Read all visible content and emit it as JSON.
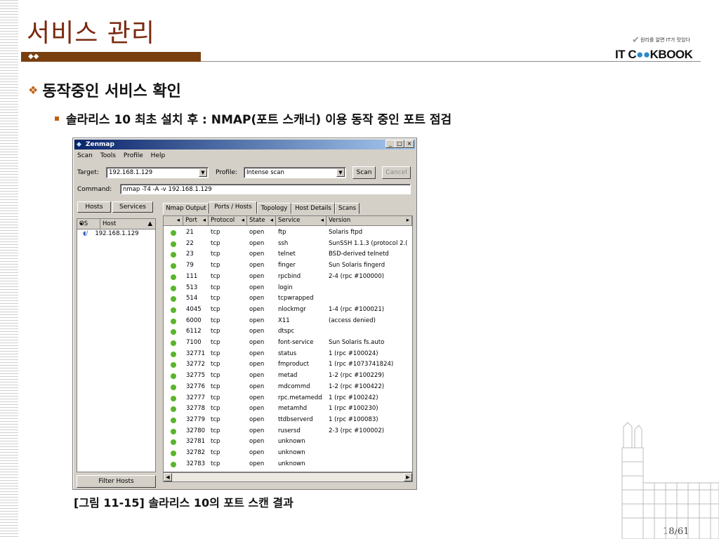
{
  "slide": {
    "title": "서비스 관리",
    "bullet1": "동작중인 서비스 확인",
    "bullet2": "솔라리스 10 최초 설치 후 : NMAP(포트 스캐너) 이용 동작 중인 포트 점검",
    "caption": "[그림 11-15] 솔라리스 10의 포트 스캔 결과",
    "page_number": "18/61",
    "logo_tagline": "원리를 알면 IT가 맛있다",
    "logo_brand_left": "IT C",
    "logo_brand_oo": "●●",
    "logo_brand_right": "KBOOK"
  },
  "window": {
    "title": "Zenmap",
    "controls": [
      "_",
      "□",
      "×"
    ],
    "menu": [
      "Scan",
      "Tools",
      "Profile",
      "Help"
    ],
    "target_label": "Target:",
    "target_value": "192.168.1.129",
    "profile_label": "Profile:",
    "profile_value": "Intense scan",
    "scan_button": "Scan",
    "cancel_button": "Cancel",
    "command_label": "Command:",
    "command_value": "nmap -T4 -A -v 192.168.1.129",
    "left_tabs": [
      "Hosts",
      "Services"
    ],
    "host_columns": [
      "OS",
      "Host"
    ],
    "hosts": [
      "192.168.1.129"
    ],
    "filter_button": "Filter Hosts",
    "tabs": [
      "Nmap Output",
      "Ports / Hosts",
      "Topology",
      "Host Details",
      "Scans"
    ],
    "active_tab": "Ports / Hosts",
    "port_columns": [
      "Port",
      "Protocol",
      "State",
      "Service",
      "Version"
    ],
    "ports": [
      {
        "port": "21",
        "protocol": "tcp",
        "state": "open",
        "service": "ftp",
        "version": "Solaris ftpd"
      },
      {
        "port": "22",
        "protocol": "tcp",
        "state": "open",
        "service": "ssh",
        "version": "SunSSH 1.1.3 (protocol 2.("
      },
      {
        "port": "23",
        "protocol": "tcp",
        "state": "open",
        "service": "telnet",
        "version": "BSD-derived telnetd"
      },
      {
        "port": "79",
        "protocol": "tcp",
        "state": "open",
        "service": "finger",
        "version": "Sun Solaris fingerd"
      },
      {
        "port": "111",
        "protocol": "tcp",
        "state": "open",
        "service": "rpcbind",
        "version": "2-4 (rpc #100000)"
      },
      {
        "port": "513",
        "protocol": "tcp",
        "state": "open",
        "service": "login",
        "version": ""
      },
      {
        "port": "514",
        "protocol": "tcp",
        "state": "open",
        "service": "tcpwrapped",
        "version": ""
      },
      {
        "port": "4045",
        "protocol": "tcp",
        "state": "open",
        "service": "nlockmgr",
        "version": "1-4 (rpc #100021)"
      },
      {
        "port": "6000",
        "protocol": "tcp",
        "state": "open",
        "service": "X11",
        "version": "(access denied)"
      },
      {
        "port": "6112",
        "protocol": "tcp",
        "state": "open",
        "service": "dtspc",
        "version": ""
      },
      {
        "port": "7100",
        "protocol": "tcp",
        "state": "open",
        "service": "font-service",
        "version": "Sun Solaris fs.auto"
      },
      {
        "port": "32771",
        "protocol": "tcp",
        "state": "open",
        "service": "status",
        "version": "1 (rpc #100024)"
      },
      {
        "port": "32772",
        "protocol": "tcp",
        "state": "open",
        "service": "fmproduct",
        "version": "1 (rpc #1073741824)"
      },
      {
        "port": "32775",
        "protocol": "tcp",
        "state": "open",
        "service": "metad",
        "version": "1-2 (rpc #100229)"
      },
      {
        "port": "32776",
        "protocol": "tcp",
        "state": "open",
        "service": "mdcommd",
        "version": "1-2 (rpc #100422)"
      },
      {
        "port": "32777",
        "protocol": "tcp",
        "state": "open",
        "service": "rpc.metamedd",
        "version": "1 (rpc #100242)"
      },
      {
        "port": "32778",
        "protocol": "tcp",
        "state": "open",
        "service": "metamhd",
        "version": "1 (rpc #100230)"
      },
      {
        "port": "32779",
        "protocol": "tcp",
        "state": "open",
        "service": "ttdbserverd",
        "version": "1 (rpc #100083)"
      },
      {
        "port": "32780",
        "protocol": "tcp",
        "state": "open",
        "service": "rusersd",
        "version": "2-3 (rpc #100002)"
      },
      {
        "port": "32781",
        "protocol": "tcp",
        "state": "open",
        "service": "unknown",
        "version": ""
      },
      {
        "port": "32782",
        "protocol": "tcp",
        "state": "open",
        "service": "unknown",
        "version": ""
      },
      {
        "port": "32783",
        "protocol": "tcp",
        "state": "open",
        "service": "unknown",
        "version": ""
      }
    ]
  },
  "colors": {
    "title": "#7a2a10",
    "accent_bar": "#7a3f0f",
    "bullet": "#c06010",
    "titlebar_start": "#0a246a",
    "titlebar_end": "#a6caf0",
    "status_open": "#59b52a"
  }
}
